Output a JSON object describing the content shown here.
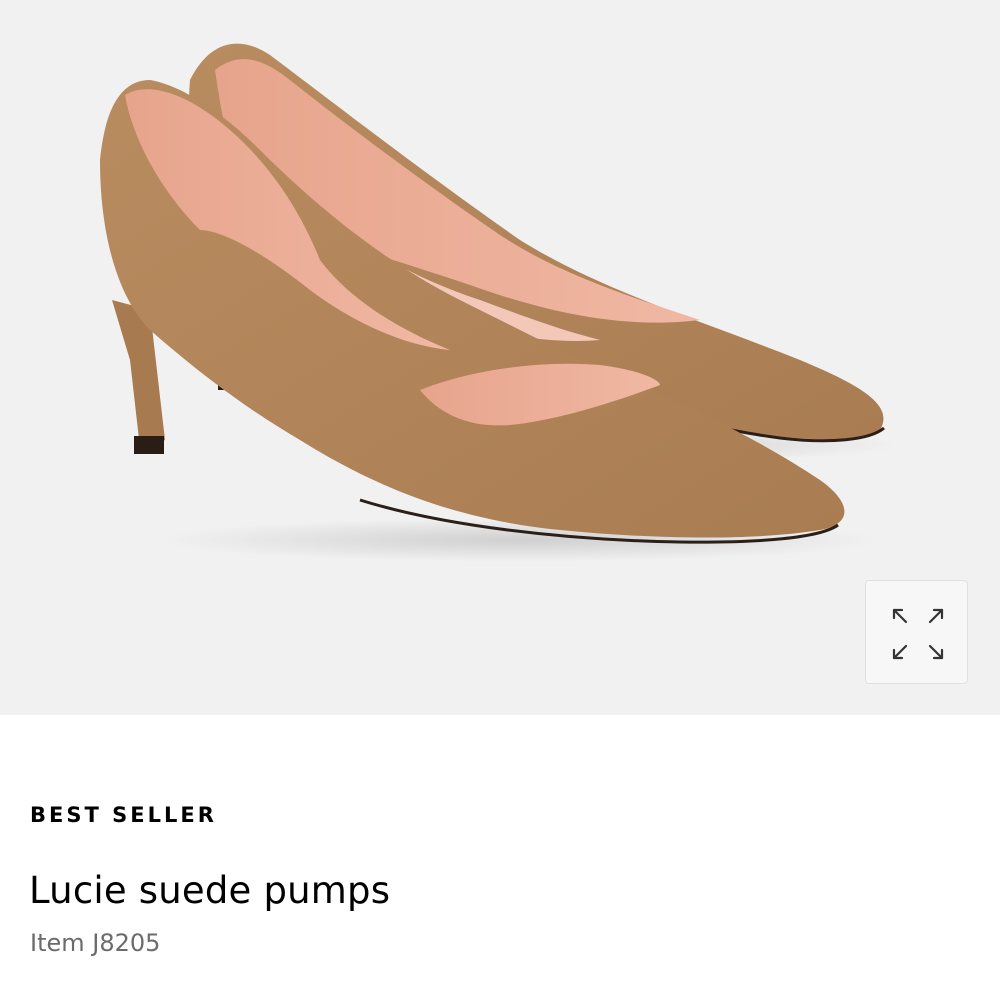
{
  "product": {
    "badge": "BEST SELLER",
    "name": "Lucie suede pumps",
    "item_number": "Item J8205",
    "image_alt": "Lucie suede pumps in camel suede",
    "colors": {
      "hero_background": "#f1f1f1",
      "suede": "#b58a5f",
      "lining": "#e9a995"
    }
  },
  "gallery": {
    "expand_icon": "expand-arrows-icon"
  }
}
